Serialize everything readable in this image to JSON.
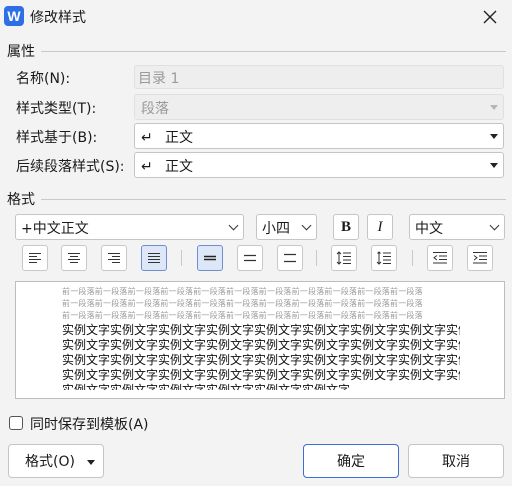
{
  "window": {
    "title": "修改样式",
    "app_icon_letter": "W"
  },
  "properties": {
    "section_label": "属性",
    "name": {
      "label": "名称(N):",
      "value": "目录 1"
    },
    "style_type": {
      "label": "样式类型(T):",
      "value": "段落"
    },
    "based_on": {
      "label": "样式基于(B):",
      "value": "正文",
      "glyph": "↵"
    },
    "next_style": {
      "label": "后续段落样式(S):",
      "value": "正文",
      "glyph": "↵"
    }
  },
  "format": {
    "section_label": "格式",
    "font_name": "+中文正文",
    "font_size": "小四",
    "bold_label": "B",
    "italic_label": "I",
    "script": "中文"
  },
  "preview": {
    "grey_lines": [
      "前一段落前一段落前一段落前一段落前一段落前一段落前一段落前一段落前一段落前一段落前一段落",
      "前一段落前一段落前一段落前一段落前一段落前一段落前一段落前一段落前一段落前一段落前一段落",
      "前一段落前一段落前一段落前一段落前一段落前一段落前一段落前一段落前一段落前一段落前一段落"
    ],
    "sample_lines": [
      "实例文字实例文字实例文字实例文字实例文字实例文字实例文字实例文字实例文字实例文字实例文字",
      "实例文字实例文字实例文字实例文字实例文字实例文字实例文字实例文字实例文字实例文字实例文字",
      "实例文字实例文字实例文字实例文字实例文字实例文字实例文字实例文字实例文字实例文字实例文字",
      "实例文字实例文字实例文字实例文字实例文字实例文字实例文字实例文字实例文字实例文字实例文字",
      "实例文字实例文字实例文字实例文字实例文字实例文字"
    ]
  },
  "footer": {
    "save_to_template_label": "同时保存到模板(A)",
    "save_to_template_checked": false,
    "format_menu_label": "格式(O)",
    "ok_label": "确定",
    "cancel_label": "取消"
  },
  "colors": {
    "accent": "#3c6fd1",
    "active_button_fill": "#dde7f8",
    "app_icon": "#2e6fe8"
  }
}
